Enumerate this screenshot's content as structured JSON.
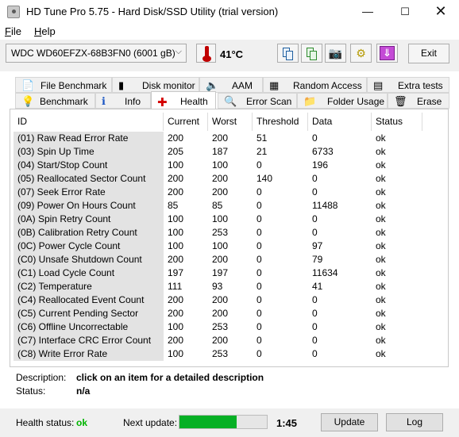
{
  "window": {
    "title": "HD Tune Pro 5.75 - Hard Disk/SSD Utility (trial version)",
    "controls": {
      "minimize": "—",
      "maximize": "☐",
      "close": "✕"
    }
  },
  "menu": {
    "file_acc": "F",
    "file_rest": "ile",
    "help_acc": "H",
    "help_rest": "elp"
  },
  "toolbar": {
    "drive": "WDC WD60EFZX-68B3FN0 (6001 gB)",
    "temperature": "41°C",
    "exit_label": "Exit",
    "icons": [
      "copy-text-icon",
      "copy-screenshot-icon",
      "camera-icon",
      "options-icon",
      "save-icon"
    ]
  },
  "tabs": {
    "row1": [
      {
        "label": "File Benchmark",
        "icon": "file-benchmark-icon",
        "glyph": "📄"
      },
      {
        "label": "Disk monitor",
        "icon": "disk-monitor-icon",
        "glyph": "▮"
      },
      {
        "label": "AAM",
        "icon": "speaker-icon",
        "glyph": "🔈"
      },
      {
        "label": "Random Access",
        "icon": "random-access-icon",
        "glyph": "▦"
      },
      {
        "label": "Extra tests",
        "icon": "extra-tests-icon",
        "glyph": "▤"
      }
    ],
    "row2": [
      {
        "label": "Benchmark",
        "icon": "lightbulb-icon",
        "glyph": "💡"
      },
      {
        "label": "Info",
        "icon": "info-icon",
        "glyph": "ℹ"
      },
      {
        "label": "Health",
        "icon": "health-cross-icon",
        "glyph": "✚"
      },
      {
        "label": "Error Scan",
        "icon": "magnifier-icon",
        "glyph": "🔍"
      },
      {
        "label": "Folder Usage",
        "icon": "folder-icon",
        "glyph": "📁"
      },
      {
        "label": "Erase",
        "icon": "trash-icon",
        "glyph": "🗑"
      }
    ],
    "active": "Health"
  },
  "health_table": {
    "columns": [
      "ID",
      "Current",
      "Worst",
      "Threshold",
      "Data",
      "Status"
    ],
    "rows": [
      [
        "(01) Raw Read Error Rate",
        "200",
        "200",
        "51",
        "0",
        "ok"
      ],
      [
        "(03) Spin Up Time",
        "205",
        "187",
        "21",
        "6733",
        "ok"
      ],
      [
        "(04) Start/Stop Count",
        "100",
        "100",
        "0",
        "196",
        "ok"
      ],
      [
        "(05) Reallocated Sector Count",
        "200",
        "200",
        "140",
        "0",
        "ok"
      ],
      [
        "(07) Seek Error Rate",
        "200",
        "200",
        "0",
        "0",
        "ok"
      ],
      [
        "(09) Power On Hours Count",
        "85",
        "85",
        "0",
        "11488",
        "ok"
      ],
      [
        "(0A) Spin Retry Count",
        "100",
        "100",
        "0",
        "0",
        "ok"
      ],
      [
        "(0B) Calibration Retry Count",
        "100",
        "253",
        "0",
        "0",
        "ok"
      ],
      [
        "(0C) Power Cycle Count",
        "100",
        "100",
        "0",
        "97",
        "ok"
      ],
      [
        "(C0) Unsafe Shutdown Count",
        "200",
        "200",
        "0",
        "79",
        "ok"
      ],
      [
        "(C1) Load Cycle Count",
        "197",
        "197",
        "0",
        "11634",
        "ok"
      ],
      [
        "(C2) Temperature",
        "111",
        "93",
        "0",
        "41",
        "ok"
      ],
      [
        "(C4) Reallocated Event Count",
        "200",
        "200",
        "0",
        "0",
        "ok"
      ],
      [
        "(C5) Current Pending Sector",
        "200",
        "200",
        "0",
        "0",
        "ok"
      ],
      [
        "(C6) Offline Uncorrectable",
        "100",
        "253",
        "0",
        "0",
        "ok"
      ],
      [
        "(C7) Interface CRC Error Count",
        "200",
        "200",
        "0",
        "0",
        "ok"
      ],
      [
        "(C8) Write Error Rate",
        "100",
        "253",
        "0",
        "0",
        "ok"
      ]
    ]
  },
  "description": {
    "label": "Description:",
    "value": "click on an item for a detailed description",
    "status_label": "Status:",
    "status_value": "n/a"
  },
  "bottom": {
    "health_label": "Health status:",
    "health_value": "ok",
    "health_color": "#00b400",
    "next_update_label": "Next update:",
    "progress_fraction": 0.65,
    "countdown": "1:45",
    "update_label": "Update",
    "log_label": "Log"
  }
}
